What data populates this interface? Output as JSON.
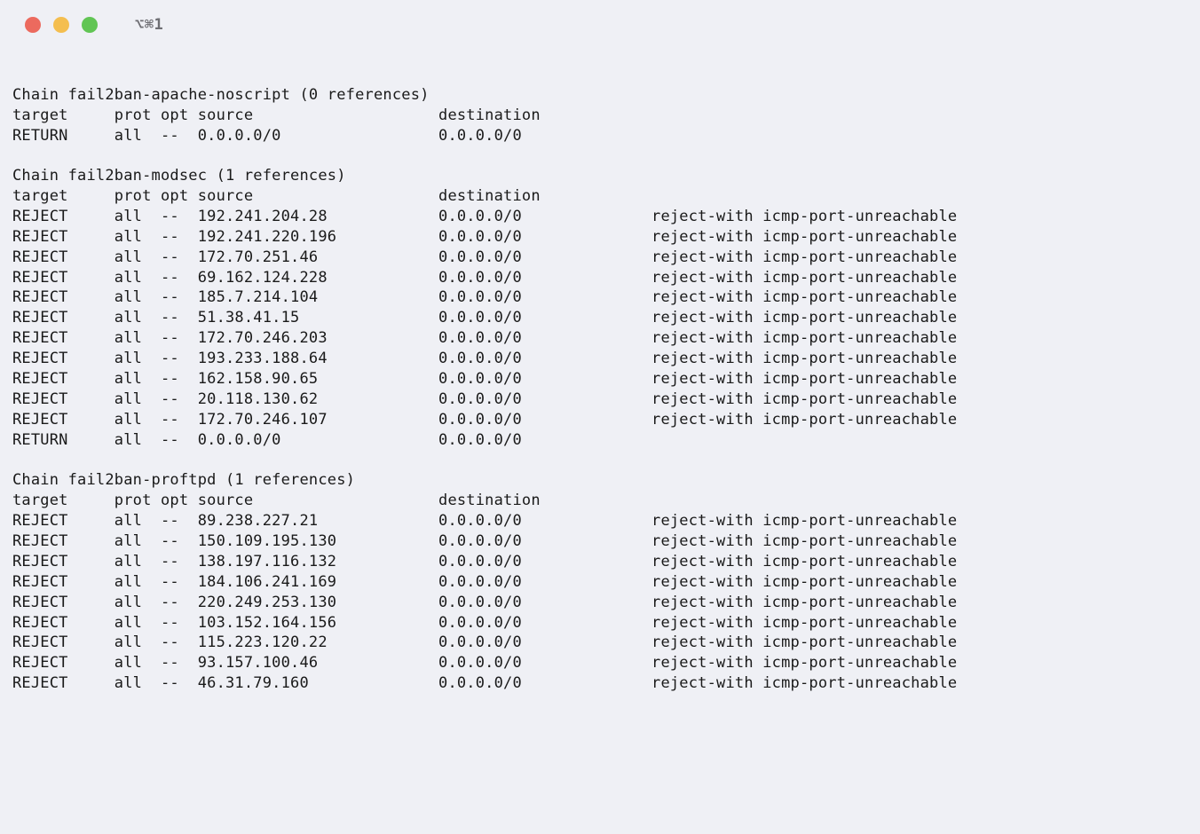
{
  "titlebar": {
    "label": "⌥⌘1"
  },
  "columns": {
    "target": "target",
    "prot": "prot",
    "opt": "opt",
    "source": "source",
    "destination": "destination"
  },
  "chain_prefix": "Chain ",
  "references_suffix": " references)",
  "reject_extra": "reject-with icmp-port-unreachable",
  "chains": [
    {
      "name": "fail2ban-apache-noscript",
      "refs": "(0",
      "rules": [
        {
          "target": "RETURN",
          "prot": "all",
          "opt": "--",
          "source": "0.0.0.0/0",
          "dest": "0.0.0.0/0",
          "extra": ""
        }
      ]
    },
    {
      "name": "fail2ban-modsec",
      "refs": "(1",
      "rules": [
        {
          "target": "REJECT",
          "prot": "all",
          "opt": "--",
          "source": "192.241.204.28",
          "dest": "0.0.0.0/0",
          "extra": "reject-with icmp-port-unreachable"
        },
        {
          "target": "REJECT",
          "prot": "all",
          "opt": "--",
          "source": "192.241.220.196",
          "dest": "0.0.0.0/0",
          "extra": "reject-with icmp-port-unreachable"
        },
        {
          "target": "REJECT",
          "prot": "all",
          "opt": "--",
          "source": "172.70.251.46",
          "dest": "0.0.0.0/0",
          "extra": "reject-with icmp-port-unreachable"
        },
        {
          "target": "REJECT",
          "prot": "all",
          "opt": "--",
          "source": "69.162.124.228",
          "dest": "0.0.0.0/0",
          "extra": "reject-with icmp-port-unreachable"
        },
        {
          "target": "REJECT",
          "prot": "all",
          "opt": "--",
          "source": "185.7.214.104",
          "dest": "0.0.0.0/0",
          "extra": "reject-with icmp-port-unreachable"
        },
        {
          "target": "REJECT",
          "prot": "all",
          "opt": "--",
          "source": "51.38.41.15",
          "dest": "0.0.0.0/0",
          "extra": "reject-with icmp-port-unreachable"
        },
        {
          "target": "REJECT",
          "prot": "all",
          "opt": "--",
          "source": "172.70.246.203",
          "dest": "0.0.0.0/0",
          "extra": "reject-with icmp-port-unreachable"
        },
        {
          "target": "REJECT",
          "prot": "all",
          "opt": "--",
          "source": "193.233.188.64",
          "dest": "0.0.0.0/0",
          "extra": "reject-with icmp-port-unreachable"
        },
        {
          "target": "REJECT",
          "prot": "all",
          "opt": "--",
          "source": "162.158.90.65",
          "dest": "0.0.0.0/0",
          "extra": "reject-with icmp-port-unreachable"
        },
        {
          "target": "REJECT",
          "prot": "all",
          "opt": "--",
          "source": "20.118.130.62",
          "dest": "0.0.0.0/0",
          "extra": "reject-with icmp-port-unreachable"
        },
        {
          "target": "REJECT",
          "prot": "all",
          "opt": "--",
          "source": "172.70.246.107",
          "dest": "0.0.0.0/0",
          "extra": "reject-with icmp-port-unreachable"
        },
        {
          "target": "RETURN",
          "prot": "all",
          "opt": "--",
          "source": "0.0.0.0/0",
          "dest": "0.0.0.0/0",
          "extra": ""
        }
      ]
    },
    {
      "name": "fail2ban-proftpd",
      "refs": "(1",
      "rules": [
        {
          "target": "REJECT",
          "prot": "all",
          "opt": "--",
          "source": "89.238.227.21",
          "dest": "0.0.0.0/0",
          "extra": "reject-with icmp-port-unreachable"
        },
        {
          "target": "REJECT",
          "prot": "all",
          "opt": "--",
          "source": "150.109.195.130",
          "dest": "0.0.0.0/0",
          "extra": "reject-with icmp-port-unreachable"
        },
        {
          "target": "REJECT",
          "prot": "all",
          "opt": "--",
          "source": "138.197.116.132",
          "dest": "0.0.0.0/0",
          "extra": "reject-with icmp-port-unreachable"
        },
        {
          "target": "REJECT",
          "prot": "all",
          "opt": "--",
          "source": "184.106.241.169",
          "dest": "0.0.0.0/0",
          "extra": "reject-with icmp-port-unreachable"
        },
        {
          "target": "REJECT",
          "prot": "all",
          "opt": "--",
          "source": "220.249.253.130",
          "dest": "0.0.0.0/0",
          "extra": "reject-with icmp-port-unreachable"
        },
        {
          "target": "REJECT",
          "prot": "all",
          "opt": "--",
          "source": "103.152.164.156",
          "dest": "0.0.0.0/0",
          "extra": "reject-with icmp-port-unreachable"
        },
        {
          "target": "REJECT",
          "prot": "all",
          "opt": "--",
          "source": "115.223.120.22",
          "dest": "0.0.0.0/0",
          "extra": "reject-with icmp-port-unreachable"
        },
        {
          "target": "REJECT",
          "prot": "all",
          "opt": "--",
          "source": "93.157.100.46",
          "dest": "0.0.0.0/0",
          "extra": "reject-with icmp-port-unreachable"
        },
        {
          "target": "REJECT",
          "prot": "all",
          "opt": "--",
          "source": "46.31.79.160",
          "dest": "0.0.0.0/0",
          "extra": "reject-with icmp-port-unreachable"
        }
      ]
    }
  ]
}
